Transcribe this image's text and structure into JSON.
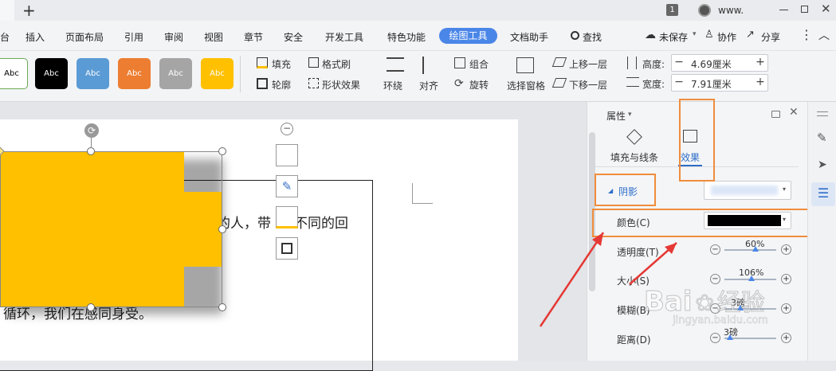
{
  "titlebar": {
    "new_tab": "+",
    "page_num": "1",
    "user": "www."
  },
  "menu": {
    "items": [
      "台",
      "插入",
      "页面布局",
      "引用",
      "审阅",
      "视图",
      "章节",
      "安全",
      "开发工具",
      "特色功能",
      "绘图工具",
      "文档助手"
    ],
    "search": "查找",
    "unsaved": "未保存",
    "collab": "协作",
    "share": "分享"
  },
  "ribbon": {
    "style_label": "Abc",
    "fill": "填充",
    "format_painter": "格式刷",
    "outline": "轮廓",
    "shape_effect": "形状效果",
    "wrap": "环绕",
    "align": "对齐",
    "group": "组合",
    "rotate": "旋转",
    "select_pane": "选择窗格",
    "bring_forward": "上移一层",
    "send_backward": "下移一层",
    "height_label": "高度:",
    "height_value": "4.69厘米",
    "width_label": "宽度:",
    "width_value": "7.91厘米"
  },
  "document": {
    "text_line1": "的人，带",
    "text_line1b": "不同的回",
    "text_line2": "循环，我们在感同身受。"
  },
  "panel": {
    "title": "属性",
    "tab_fill": "填充与线条",
    "tab_effect": "效果",
    "section_shadow": "阴影",
    "color_label": "颜色(C)",
    "transparency_label": "透明度(T)",
    "transparency_value": "60%",
    "size_label": "大小(S)",
    "size_value": "106%",
    "blur_label": "模糊(B)",
    "blur_value": "3磅",
    "distance_label": "距离(D)",
    "distance_value": "3磅",
    "transparency_level": 0.6,
    "size_level": 0.53,
    "blur_level": 0.3,
    "distance_level": 0.1
  },
  "watermark": {
    "brand": "Bai",
    "brand2": "经验",
    "url": "jingyan.baidu.com"
  },
  "colors": {
    "accent": "#4a86e8",
    "shape": "#ffc000",
    "highlight": "#ef8d3c",
    "arrow": "#e53935"
  }
}
